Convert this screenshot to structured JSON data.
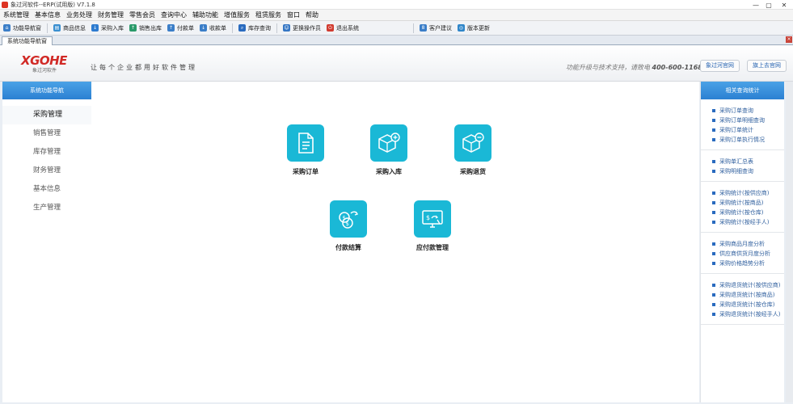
{
  "window": {
    "title": "象过河软件--ERP(试用版) V7.1.8",
    "controls": [
      "—",
      "▢",
      "✕"
    ]
  },
  "menu": [
    "系统管理",
    "基本信息",
    "业务处理",
    "财务管理",
    "零售会员",
    "查询中心",
    "辅助功能",
    "增值服务",
    "租赁服务",
    "窗口",
    "帮助"
  ],
  "toolbar": [
    {
      "label": "功能导航窗",
      "icon": "home-icon"
    },
    {
      "label": "商品信息",
      "icon": "goods-icon"
    },
    {
      "label": "采购入库",
      "icon": "purchase-in-icon"
    },
    {
      "label": "销售出库",
      "icon": "sale-out-icon"
    },
    {
      "label": "付款单",
      "icon": "payment-icon"
    },
    {
      "label": "收款单",
      "icon": "receipt-icon"
    },
    {
      "label": "库存查询",
      "icon": "stock-query-icon"
    },
    {
      "label": "更换操作员",
      "icon": "switch-user-icon"
    },
    {
      "label": "退出系统",
      "icon": "exit-icon"
    },
    {
      "label": "客户建议",
      "icon": "suggestion-icon"
    },
    {
      "label": "版本更新",
      "icon": "update-icon"
    }
  ],
  "tab": {
    "label": "系统功能导航窗"
  },
  "header": {
    "logo": "XGOHE",
    "logo_sub": "象过河软件",
    "slogan": "让每个企业都用好软件管理",
    "support_text": "功能升级与技术支持，请致电",
    "phone": "400-600-1168",
    "btn_site": "象过河官网",
    "btn_forum": "旗上去官网"
  },
  "sidebar": {
    "title": "系统功能导航",
    "items": [
      "采购管理",
      "销售管理",
      "库存管理",
      "财务管理",
      "基本信息",
      "生产管理"
    ],
    "active": 0
  },
  "functions": [
    {
      "label": "采购订单",
      "icon": "document-icon"
    },
    {
      "label": "采购入库",
      "icon": "box-add-icon"
    },
    {
      "label": "采购退货",
      "icon": "box-remove-icon"
    },
    {
      "label": "付款结算",
      "icon": "coin-exchange-icon"
    },
    {
      "label": "应付款管理",
      "icon": "payable-monitor-icon"
    }
  ],
  "right_panel": {
    "title": "相关查询统计",
    "groups": [
      [
        "采购订单查询",
        "采购订单明细查询",
        "采购订单统计",
        "采购订单执行情况"
      ],
      [
        "采购单汇总表",
        "采购明细查询"
      ],
      [
        "采购统计(按供应商)",
        "采购统计(按商品)",
        "采购统计(按仓库)",
        "采购统计(按经手人)"
      ],
      [
        "采购商品月度分析",
        "供应商供货月度分析",
        "采购价格趋势分析"
      ],
      [
        "采购退货统计(按供应商)",
        "采购退货统计(按商品)",
        "采购退货统计(按仓库)",
        "采购退货统计(按经手人)"
      ]
    ]
  },
  "colors": {
    "accent": "#1ab8d6",
    "nav_header": "#2b80d2",
    "logo": "#d12a26"
  }
}
